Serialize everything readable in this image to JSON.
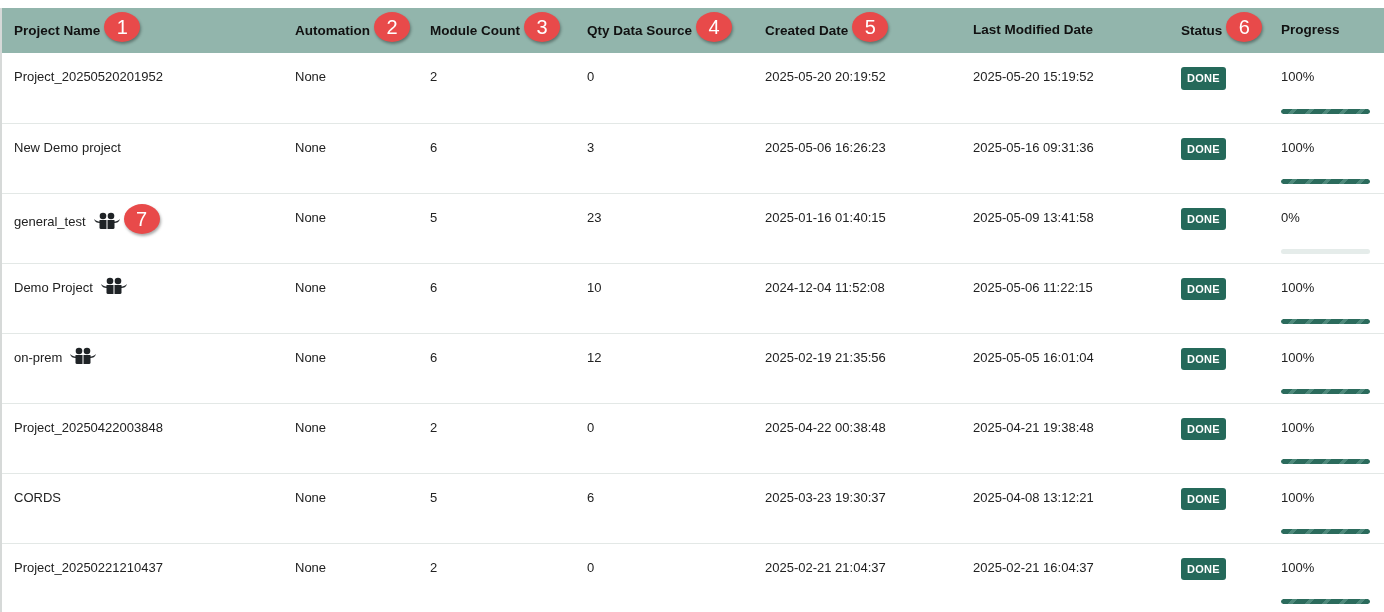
{
  "table": {
    "columns": [
      {
        "label": "Project Name",
        "callout": "1"
      },
      {
        "label": "Automation",
        "callout": "2"
      },
      {
        "label": "Module Count",
        "callout": "3"
      },
      {
        "label": "Qty Data Source",
        "callout": "4"
      },
      {
        "label": "Created Date",
        "callout": "5"
      },
      {
        "label": "Last Modified Date"
      },
      {
        "label": "Status",
        "callout": "6"
      },
      {
        "label": "Progress"
      }
    ],
    "rows": [
      {
        "name": "Project_20250520201952",
        "shared": false,
        "automation": "None",
        "modules": "2",
        "sources": "0",
        "created": "2025-05-20 20:19:52",
        "modified": "2025-05-20 15:19:52",
        "status": "DONE",
        "progress": "100%",
        "level": 1
      },
      {
        "name": "New Demo project",
        "shared": false,
        "automation": "None",
        "modules": "6",
        "sources": "3",
        "created": "2025-05-06 16:26:23",
        "modified": "2025-05-16 09:31:36",
        "status": "DONE",
        "progress": "100%",
        "level": 1
      },
      {
        "name": "general_test",
        "shared": true,
        "callout": "7",
        "automation": "None",
        "modules": "5",
        "sources": "23",
        "created": "2025-01-16 01:40:15",
        "modified": "2025-05-09 13:41:58",
        "status": "DONE",
        "progress": "0%",
        "level": 0
      },
      {
        "name": "Demo Project",
        "shared": true,
        "automation": "None",
        "modules": "6",
        "sources": "10",
        "created": "2024-12-04 11:52:08",
        "modified": "2025-05-06 11:22:15",
        "status": "DONE",
        "progress": "100%",
        "level": 1
      },
      {
        "name": "on-prem",
        "shared": true,
        "automation": "None",
        "modules": "6",
        "sources": "12",
        "created": "2025-02-19 21:35:56",
        "modified": "2025-05-05 16:01:04",
        "status": "DONE",
        "progress": "100%",
        "level": 1
      },
      {
        "name": "Project_20250422003848",
        "shared": false,
        "automation": "None",
        "modules": "2",
        "sources": "0",
        "created": "2025-04-22 00:38:48",
        "modified": "2025-04-21 19:38:48",
        "status": "DONE",
        "progress": "100%",
        "level": 1
      },
      {
        "name": "CORDS",
        "shared": false,
        "automation": "None",
        "modules": "5",
        "sources": "6",
        "created": "2025-03-23 19:30:37",
        "modified": "2025-04-08 13:12:21",
        "status": "DONE",
        "progress": "100%",
        "level": 1
      },
      {
        "name": "Project_20250221210437",
        "shared": false,
        "automation": "None",
        "modules": "2",
        "sources": "0",
        "created": "2025-02-21 21:04:37",
        "modified": "2025-02-21 16:04:37",
        "status": "DONE",
        "progress": "100%",
        "level": 1
      }
    ]
  }
}
